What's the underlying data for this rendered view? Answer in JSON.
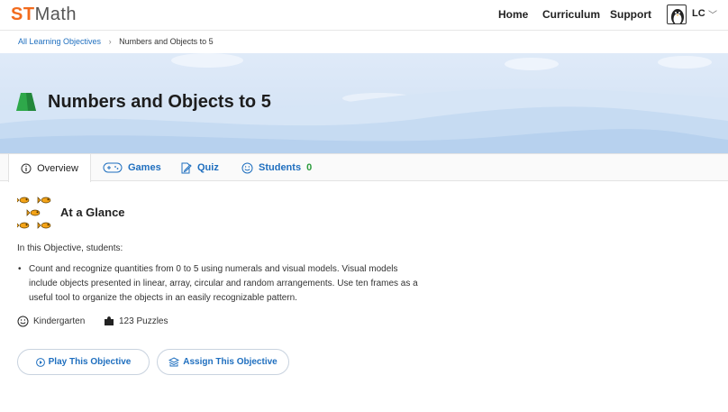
{
  "header": {
    "logo_st": "ST",
    "logo_math": "Math",
    "nav": [
      "Home",
      "Curriculum",
      "Support"
    ],
    "user_initials": "LC"
  },
  "breadcrumb": {
    "root": "All Learning Objectives",
    "separator": "›",
    "current": "Numbers and Objects to 5"
  },
  "page": {
    "title": "Numbers and Objects to 5"
  },
  "tabs": [
    {
      "label": "Overview",
      "icon": "info-circle-icon",
      "active": true
    },
    {
      "label": "Games",
      "icon": "gamepad-icon"
    },
    {
      "label": "Quiz",
      "icon": "quiz-edit-icon"
    },
    {
      "label": "Students",
      "icon": "smiley-icon",
      "count": "0"
    }
  ],
  "overview": {
    "section_title": "At a Glance",
    "intro": "In this Objective, students:",
    "bullets": [
      "Count and recognize quantities from 0 to 5 using numerals and visual models. Visual models include objects presented in linear, array, circular and random arrangements. Use ten frames as a useful tool to organize the objects in an easily recognizable pattern."
    ],
    "grade": "Kindergarten",
    "puzzles": "123 Puzzles"
  },
  "actions": {
    "play": "Play This Objective",
    "assign": "Assign This Objective"
  },
  "colors": {
    "brand_orange": "#f26b1d",
    "link_blue": "#1f6fbf",
    "accent_green": "#2c9c3d"
  }
}
